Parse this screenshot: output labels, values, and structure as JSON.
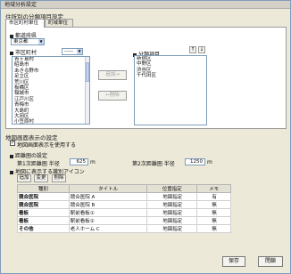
{
  "window": {
    "title": "地域分析設定"
  },
  "section1": {
    "title": "住所別の分類項目設定"
  },
  "tabs": [
    {
      "label": "市区町村単位"
    },
    {
      "label": "町域単位"
    }
  ],
  "pref": {
    "label": "都道府県",
    "value": "東京都"
  },
  "city": {
    "label": "市区町村",
    "filter": "-----",
    "items": [
      "青ヶ島村",
      "昭島市",
      "あきる野市",
      "足立区",
      "荒川区",
      "板橋区",
      "稲城市",
      "江戸川区",
      "青梅市",
      "大島町",
      "大田区",
      "小笠原村"
    ]
  },
  "move": {
    "add": "追加→",
    "remove": "←削除"
  },
  "classified": {
    "label": "分類項目",
    "up": "↑",
    "down": "↓",
    "items": [
      "新宿区",
      "中野区",
      "渋谷区",
      "千代田区"
    ]
  },
  "section2": {
    "title": "地図画面表示の設定"
  },
  "map_checkbox": {
    "label": "地図画面表示を使用する",
    "checked": "✓"
  },
  "radius": {
    "label": "距離圏の設定",
    "first_label": "第1次距離圏 半径",
    "first_value": "625",
    "first_unit": "m",
    "second_label": "第2次距離圏 半径",
    "second_value": "1250",
    "second_unit": "m"
  },
  "icons": {
    "label": "地図に表示する識別アイコン",
    "add": "追加",
    "edit": "変更",
    "delete": "削除"
  },
  "table": {
    "headers": [
      "種別",
      "タイトル",
      "位置指定",
      "メモ"
    ],
    "rows": [
      [
        "競合医院",
        "競合医院 A",
        "地図指定",
        "有"
      ],
      [
        "競合医院",
        "競合医院 B",
        "地図指定",
        "無"
      ],
      [
        "看板",
        "駅前看板①",
        "地図指定",
        "無"
      ],
      [
        "看板",
        "駅前看板②",
        "地図指定",
        "無"
      ],
      [
        "その他",
        "老人ホーム C",
        "地図指定",
        "無"
      ]
    ]
  },
  "footer": {
    "save": "保存",
    "close": "閉鎖"
  }
}
